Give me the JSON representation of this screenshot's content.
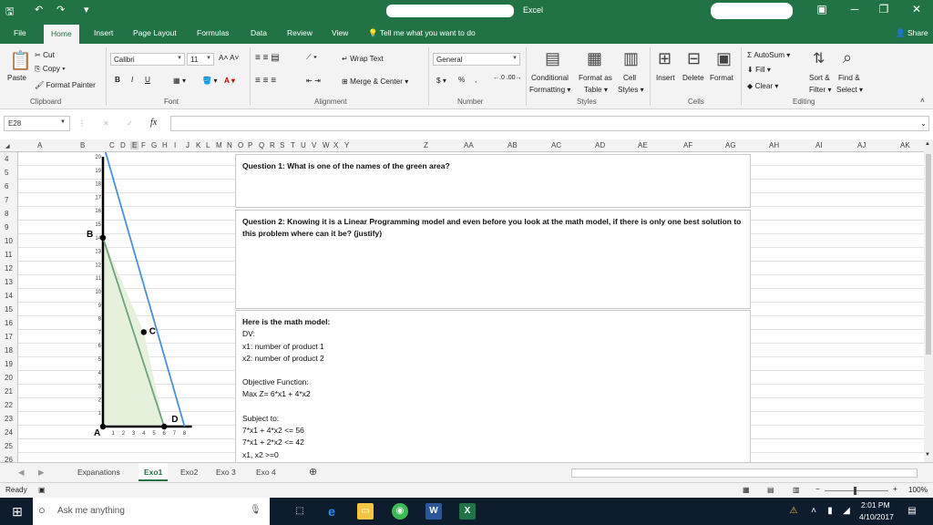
{
  "titlebar": {
    "app_name": "Excel"
  },
  "tabs": [
    "File",
    "Home",
    "Insert",
    "Page Layout",
    "Formulas",
    "Data",
    "Review",
    "View"
  ],
  "tell_me": "Tell me what you want to do",
  "share": "Share",
  "ribbon": {
    "clipboard": {
      "paste": "Paste",
      "cut": "Cut",
      "copy": "Copy",
      "format_painter": "Format Painter",
      "label": "Clipboard"
    },
    "font": {
      "name": "Calibri",
      "size": "11",
      "bold": "B",
      "italic": "I",
      "underline": "U",
      "label": "Font"
    },
    "alignment": {
      "wrap_text": "Wrap Text",
      "merge_center": "Merge & Center",
      "label": "Alignment"
    },
    "number": {
      "format": "General",
      "currency": "$",
      "percent": "%",
      "comma": ",",
      "label": "Number"
    },
    "styles": {
      "conditional": "Conditional",
      "formatting": "Formatting",
      "format_as": "Format as",
      "table": "Table",
      "cell": "Cell",
      "cell_styles": "Styles",
      "label": "Styles"
    },
    "cells": {
      "insert": "Insert",
      "delete": "Delete",
      "format": "Format",
      "label": "Cells"
    },
    "editing": {
      "autosum": "AutoSum",
      "fill": "Fill",
      "clear": "Clear",
      "sort": "Sort &",
      "filter": "Filter",
      "find": "Find &",
      "select": "Select",
      "label": "Editing"
    }
  },
  "formula_bar": {
    "name_box": "E28",
    "fx": "fx",
    "cancel": "✕",
    "enter": "✓",
    "content": ""
  },
  "columns": [
    "A",
    "B",
    "C",
    "D",
    "E",
    "F",
    "G",
    "H",
    "I",
    "J",
    "K",
    "L",
    "M",
    "N",
    "O",
    "P",
    "Q",
    "R",
    "S",
    "T",
    "U",
    "V",
    "W",
    "X",
    "Y",
    "Z",
    "AA",
    "AB",
    "AC",
    "AD",
    "AE",
    "AF",
    "AG",
    "AH",
    "AI",
    "AJ",
    "AK"
  ],
  "rows": [
    "4",
    "5",
    "6",
    "7",
    "8",
    "9",
    "10",
    "11",
    "12",
    "13",
    "14",
    "15",
    "16",
    "17",
    "18",
    "19",
    "20",
    "21",
    "22",
    "23",
    "24",
    "25",
    "26"
  ],
  "chart_data": {
    "type": "line",
    "title": "",
    "xlabel": "",
    "ylabel": "",
    "xlim": [
      0,
      8
    ],
    "ylim": [
      0,
      20
    ],
    "x_ticks": [
      "1",
      "2",
      "3",
      "4",
      "5",
      "6",
      "7",
      "8"
    ],
    "y_ticks": [
      "1",
      "2",
      "3",
      "4",
      "5",
      "6",
      "7",
      "8",
      "9",
      "10",
      "11",
      "12",
      "13",
      "14",
      "15",
      "16",
      "17",
      "18",
      "19",
      "20"
    ],
    "series": [
      {
        "values": [
          [
            0,
            14
          ],
          [
            6,
            0
          ]
        ]
      },
      {
        "values": [
          [
            0,
            21
          ],
          [
            8,
            0
          ]
        ]
      }
    ],
    "feasible_region": [
      [
        0,
        0
      ],
      [
        0,
        14
      ],
      [
        4,
        7
      ],
      [
        6,
        0
      ]
    ],
    "points": [
      {
        "label": "A",
        "x": 0,
        "y": 0
      },
      {
        "label": "B",
        "x": 0,
        "y": 14
      },
      {
        "label": "C",
        "x": 4,
        "y": 7
      },
      {
        "label": "D",
        "x": 6,
        "y": 0
      }
    ],
    "colors": {
      "line1": "#6aa37c",
      "line2": "#4a90d9",
      "region": "#e6f1dc"
    }
  },
  "textboxes": {
    "q1": "Question 1: What is one of the names of the green area?",
    "q2": "Question 2: Knowing it is a Linear Programming model and even before you look at the math model, if there is only one best solution to this problem where can it be? (justify)",
    "model": {
      "heading": "Here is the math model:",
      "dv": "DV:",
      "x1": "x1: number of product 1",
      "x2": "x2: number of product 2",
      "objective_label": "Objective Function:",
      "objective": "Max Z= 6*x1 + 4*x2",
      "subject_to": "Subject to:",
      "c1": "7*x1 + 4*x2 <= 56",
      "c2": "7*x1 + 2*x2 <= 42",
      "c3": "x1, x2 >=0"
    }
  },
  "sheets": [
    "Expanations",
    "Exo1",
    "Exo2",
    "Exo 3",
    "Exo 4"
  ],
  "status": {
    "ready": "Ready",
    "zoom": "100%"
  },
  "taskbar": {
    "search": "Ask me anything",
    "time": "2:01 PM",
    "date": "4/10/2017"
  }
}
